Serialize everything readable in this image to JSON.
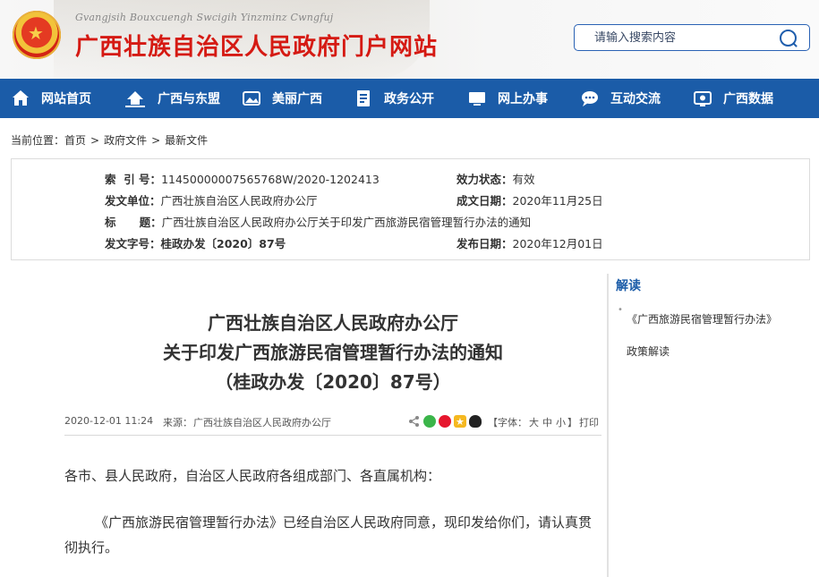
{
  "header": {
    "pinyin": "Gvangjsih Bouxcuengh Swcigih Yinzminz Cwngfuj",
    "title": "广西壮族自治区人民政府门户网站",
    "search_placeholder": "请输入搜索内容",
    "brand_color": "#d51a13"
  },
  "nav": {
    "bg_color": "#1b5ca8",
    "items": [
      {
        "label": "网站首页",
        "icon": "home-icon"
      },
      {
        "label": "广西与东盟",
        "icon": "building-icon"
      },
      {
        "label": "美丽广西",
        "icon": "landscape-icon"
      },
      {
        "label": "政务公开",
        "icon": "document-icon"
      },
      {
        "label": "网上办事",
        "icon": "monitor-icon"
      },
      {
        "label": "互动交流",
        "icon": "chat-icon"
      },
      {
        "label": "广西数据",
        "icon": "screen-icon"
      }
    ]
  },
  "breadcrumb": {
    "prefix": "当前位置：",
    "items": [
      "首页",
      "政府文件",
      "最新文件"
    ],
    "separator": ">"
  },
  "info": {
    "index_label": "索  引 号：",
    "index_value": "11450000007565768W/2020-1202413",
    "status_label": "效力状态：",
    "status_value": "有效",
    "issuer_label": "发文单位：",
    "issuer_value": "广西壮族自治区人民政府办公厅",
    "created_label": "成文日期：",
    "created_value": "2020年11月25日",
    "title_label": "标      题：",
    "title_value": "广西壮族自治区人民政府办公厅关于印发广西旅游民宿管理暂行办法的通知",
    "docno_label": "发文字号：",
    "docno_value": "桂政办发〔2020〕87号",
    "published_label": "发布日期：",
    "published_value": "2020年12月01日"
  },
  "article": {
    "title_line1": "广西壮族自治区人民政府办公厅",
    "title_line2": "关于印发广西旅游民宿管理暂行办法的通知",
    "title_line3": "（桂政办发〔2020〕87号）",
    "date": "2020-12-01 11:24",
    "source_label": "来源：",
    "source": "广西壮族自治区人民政府办公厅",
    "font_label_open": "【字体：",
    "font_large": "大",
    "font_medium": "中",
    "font_small": "小",
    "font_label_close": "】",
    "print_label": "打印",
    "paragraph1": "各市、县人民政府，自治区人民政府各组成部门、各直属机构：",
    "paragraph2": "《广西旅游民宿管理暂行办法》已经自治区人民政府同意，现印发给你们，请认真贯彻执行。"
  },
  "sidebar": {
    "title": "解读",
    "bullet": "•",
    "link": "《广西旅游民宿管理暂行办法》政策解读"
  },
  "share_icons": [
    "share-icon",
    "wechat-icon",
    "weibo-icon",
    "qzone-icon",
    "qq-icon"
  ]
}
